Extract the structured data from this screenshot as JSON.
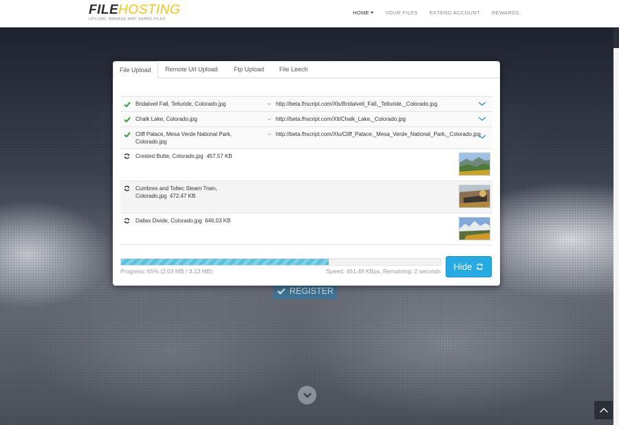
{
  "header": {
    "logo_file": "FILE",
    "logo_hosting": "HOSTING",
    "logo_tagline": "UPLOAD, MANAGE AND SHARE FILES",
    "nav": [
      {
        "label": "HOME",
        "active": true
      },
      {
        "label": "YOUR FILES",
        "active": false
      },
      {
        "label": "EXTEND ACCOUNT",
        "active": false
      },
      {
        "label": "REWARDS",
        "active": false
      }
    ]
  },
  "modal": {
    "tabs": [
      {
        "label": "File Upload",
        "active": true
      },
      {
        "label": "Remote Url Upload",
        "active": false
      },
      {
        "label": "Ftp Upload",
        "active": false
      },
      {
        "label": "File Leech",
        "active": false
      }
    ],
    "completed": [
      {
        "name": "Bridalveil Fall, Telluride, Colorado.jpg",
        "url": "http://beta.fhscript.com/Xls/Bridalveil_Fall,_Telluride,_Colorado.jpg"
      },
      {
        "name": "Chalk Lake, Colorado.jpg",
        "url": "http://beta.fhscript.com/Xlt/Chalk_Lake,_Colorado.jpg"
      },
      {
        "name": "Cliff Palace, Mesa Verde National Park, Colorado.jpg",
        "url": "http://beta.fhscript.com/Xlu/Cliff_Palace,_Mesa_Verde_National_Park,_Colorado.jpg"
      }
    ],
    "pending": [
      {
        "name": "Crested Butte, Colorado.jpg",
        "size": "457.57 KB"
      },
      {
        "name": "Cumbres and Toltec Steam Train, Colorado.jpg",
        "size": "472.47 KB"
      },
      {
        "name": "Dallas Divide, Colorado.jpg",
        "size": "646.03 KB"
      }
    ],
    "progress_percent": 65,
    "progress_label": "Progress: 65% (2.03 MB / 3.13 MB)",
    "speed_label": "Speed: 461.49 KBps, Remaining: 2 seconds",
    "hide_label": "Hide"
  },
  "hero": {
    "register_label": "REGISTER"
  },
  "colors": {
    "accent": "#27a9e1",
    "progress": "#5bc0de",
    "logo_yellow": "#f2c318",
    "success": "#2e9a3a"
  }
}
